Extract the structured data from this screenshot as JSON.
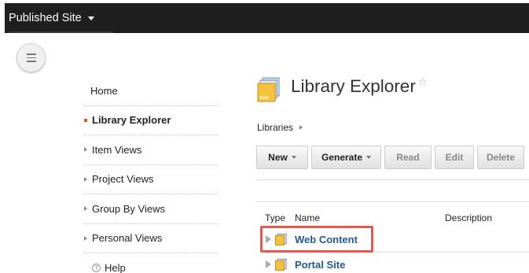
{
  "topbar": {
    "site_label": "Published Site"
  },
  "nav": {
    "items": [
      {
        "label": "Home"
      },
      {
        "label": "Library Explorer"
      },
      {
        "label": "Item Views"
      },
      {
        "label": "Project Views"
      },
      {
        "label": "Group By Views"
      },
      {
        "label": "Personal Views"
      },
      {
        "label": "Help"
      }
    ]
  },
  "page": {
    "title": "Library Explorer",
    "star": "☆"
  },
  "breadcrumb": {
    "root": "Libraries"
  },
  "toolbar": {
    "new": "New",
    "generate": "Generate",
    "read": "Read",
    "edit": "Edit",
    "delete": "Delete"
  },
  "table": {
    "headers": {
      "type": "Type",
      "name": "Name",
      "description": "Description"
    },
    "rows": [
      {
        "name": "Web Content"
      },
      {
        "name": "Portal Site"
      }
    ]
  },
  "colors": {
    "accent_bullet": "#e05a1a",
    "link": "#1f5a8c",
    "highlight": "#e8584a",
    "topbar": "#1f1f1f"
  },
  "icons": [
    "menu-icon",
    "library-icon",
    "star-icon",
    "folder-icon",
    "help-icon"
  ]
}
